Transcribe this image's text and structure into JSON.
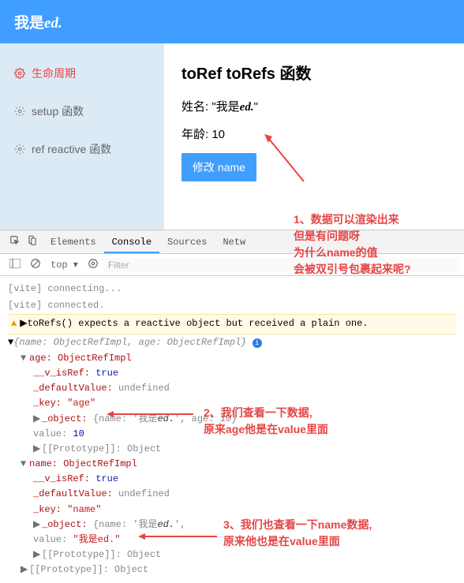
{
  "header": {
    "title_prefix": "我是",
    "title_ed": "ed."
  },
  "sidebar": {
    "items": [
      {
        "label": "生命周期"
      },
      {
        "label": "setup 函数"
      },
      {
        "label": "ref reactive 函数"
      }
    ]
  },
  "content": {
    "title": "toRef toRefs 函数",
    "name_label": "姓名:",
    "name_value_prefix": "\"我是",
    "name_value_ed": "ed.",
    "name_value_suffix": "\"",
    "age_label": "年龄:",
    "age_value": "10",
    "button": "修改 name"
  },
  "annotations": {
    "a1_line1": "1、数据可以渲染出来",
    "a1_line2": "但是有问题呀",
    "a1_line3_pre": "为什么",
    "a1_line3_name": "name",
    "a1_line3_post": "的值",
    "a1_line4": "会被双引号包裹起来呢?",
    "a2_line1": "2、我们查看一下数据,",
    "a2_line2_pre": "原来",
    "a2_line2_age": "age",
    "a2_line2_mid": "他是在",
    "a2_line2_value": "value",
    "a2_line2_post": "里面",
    "a3_line1_pre": "3、我们也查看一下",
    "a3_line1_name": "name",
    "a3_line1_post": "数据,",
    "a3_line2_pre": "原来他也是在",
    "a3_line2_value": "value",
    "a3_line2_post": "里面"
  },
  "devtools": {
    "tabs": [
      "Elements",
      "Console",
      "Sources",
      "Netw"
    ],
    "toolbar_top": "top",
    "filter_placeholder": "Filter",
    "log1": "[vite] connecting...",
    "log2": "[vite] connected.",
    "warn": "toRefs() expects a reactive object but received a plain one.",
    "root": "{name: ObjectRefImpl, age: ObjectRefImpl}",
    "age_header": "age: ObjectRefImpl",
    "isRef": "__v_isRef:",
    "isRef_val": "true",
    "defVal": "_defaultValue:",
    "defVal_val": "undefined",
    "key": "_key:",
    "key_age": "\"age\"",
    "key_name": "\"name\"",
    "object": "_object:",
    "object_val_pre": "{name: '我是",
    "object_val_ed": "ed.",
    "object_val_post": "', age: 10}",
    "value": "value:",
    "value_age": "10",
    "value_name": "\"我是ed.\"",
    "proto": "[[Prototype]]: Object",
    "name_header": "name: ObjectRefImpl",
    "proto_outer": "[[Prototype]]: Object"
  }
}
